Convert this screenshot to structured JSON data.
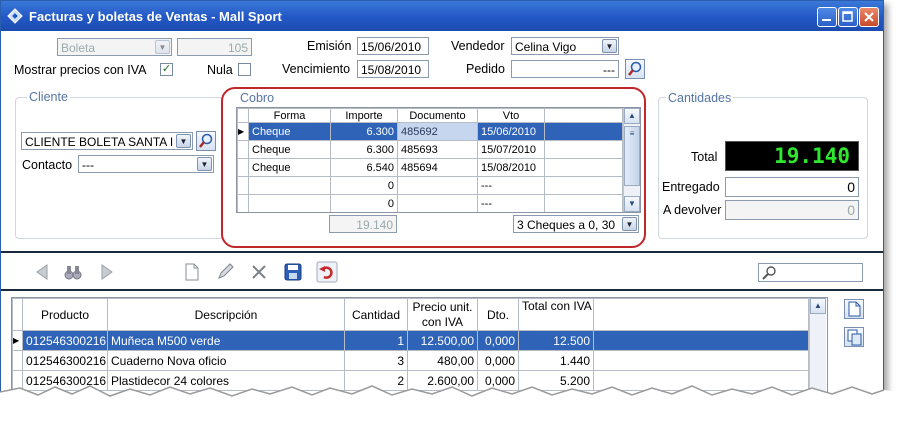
{
  "window": {
    "title": "Facturas y boletas de Ventas - Mall Sport"
  },
  "header": {
    "doc_type": "Boleta",
    "doc_number": "105",
    "emision_label": "Emisión",
    "emision_value": "15/06/2010",
    "vendedor_label": "Vendedor",
    "vendedor_value": "Celina Vigo",
    "vencimiento_label": "Vencimiento",
    "vencimiento_value": "15/08/2010",
    "pedido_label": "Pedido",
    "pedido_value": "---",
    "mostrar_iva_label": "Mostrar precios con IVA",
    "nula_label": "Nula"
  },
  "cliente": {
    "group_title": "Cliente",
    "value": "CLIENTE BOLETA SANTA I",
    "contacto_label": "Contacto",
    "contacto_value": "---"
  },
  "cobro": {
    "group_title": "Cobro",
    "columns": [
      "Forma",
      "Importe",
      "Documento",
      "Vto"
    ],
    "rows": [
      [
        "Cheque",
        "6.300",
        "485692",
        "15/06/2010"
      ],
      [
        "Cheque",
        "6.300",
        "485693",
        "15/07/2010"
      ],
      [
        "Cheque",
        "6.540",
        "485694",
        "15/08/2010"
      ],
      [
        "",
        "0",
        "",
        "---"
      ],
      [
        "",
        "0",
        "",
        "---"
      ]
    ],
    "total": "19.140",
    "plan": "3 Cheques a 0, 30"
  },
  "cantidades": {
    "group_title": "Cantidades",
    "total_label": "Total",
    "total_value": "19.140",
    "entregado_label": "Entregado",
    "entregado_value": "0",
    "devolver_label": "A devolver",
    "devolver_value": "0"
  },
  "products": {
    "columns": [
      "Producto",
      "Descripción",
      "Cantidad",
      "Precio unit.",
      "con IVA",
      "Dto.",
      "Total con IVA"
    ],
    "rows": [
      [
        "012546300216",
        "Muñeca M500 verde",
        "1",
        "12.500,00",
        "0,000",
        "12.500"
      ],
      [
        "012546300216",
        "Cuaderno Nova oficio",
        "3",
        "480,00",
        "0,000",
        "1.440"
      ],
      [
        "012546300216",
        "Plastidecor 24 colores",
        "2",
        "2.600,00",
        "0,000",
        "5.200"
      ]
    ]
  },
  "colors": {
    "title_bar": "#2257c4",
    "selection": "#2e63b8",
    "display_bg": "#000000",
    "display_text": "#2ee82e",
    "highlight": "#c0262a"
  }
}
